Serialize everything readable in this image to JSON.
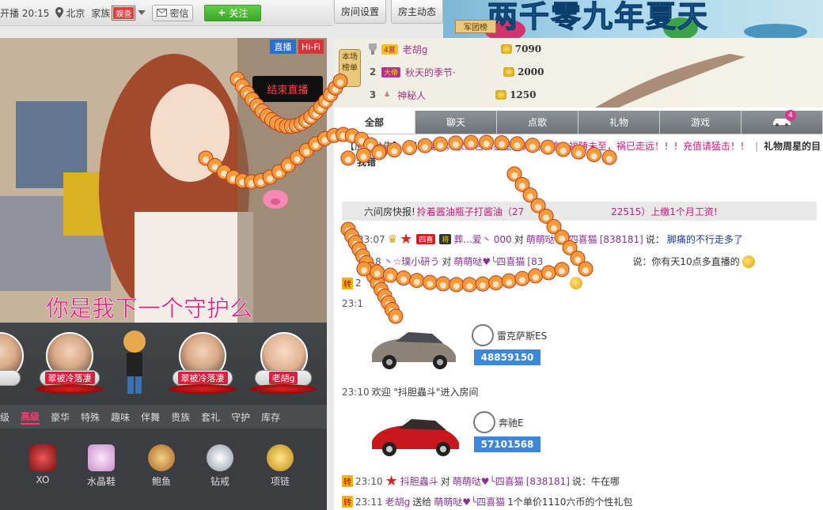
{
  "topbar": {
    "live_time": "开播 20:15",
    "location": "北京",
    "family": "家族",
    "family_tag": "娱查",
    "message": "密信",
    "follow": "关注"
  },
  "room_buttons": {
    "settings": "房间设置",
    "host_news": "房主动态"
  },
  "banner": {
    "title": "两千零九年夏天",
    "army_rank": "军团榜"
  },
  "video": {
    "badge_live": "直播",
    "badge_hifi": "Hi-Fi",
    "end_live": "结束直播",
    "overlay_text": "你是我下一个守护么"
  },
  "avatars": [
    {
      "name": "翠被冷落凄"
    },
    {
      "name": "翠被冷落凄"
    },
    {
      "name": "老胡g"
    }
  ],
  "gift_tabs": [
    "级",
    "高级",
    "豪华",
    "特殊",
    "趣味",
    "伴舞",
    "贵族",
    "套礼",
    "守护",
    "库存"
  ],
  "gift_tabs_active": "高级",
  "gifts": [
    {
      "name": "XO",
      "color": "#b4232a"
    },
    {
      "name": "水晶鞋",
      "color": "#d8a6d8"
    },
    {
      "name": "鲍鱼",
      "color": "#c98a3a"
    },
    {
      "name": "钻戒",
      "color": "#9aa7b3"
    },
    {
      "name": "项链",
      "color": "#d4a52a"
    }
  ],
  "rank": {
    "label": "本场榜单",
    "rows": [
      {
        "num": "1",
        "badge": "4富",
        "name": "老胡g",
        "score": "7090"
      },
      {
        "num": "2",
        "badge": "大帝",
        "name": "秋天的季节·",
        "score": "2000"
      },
      {
        "num": "3",
        "badge": "",
        "name": "神秘人",
        "score": "1250"
      }
    ]
  },
  "chat_tabs": [
    "全部",
    "聊天",
    "点歌",
    "礼物",
    "游戏"
  ],
  "chat_tab_active": "全部",
  "car_count": "4",
  "chat": {
    "announcement_label": "【房间公告】:",
    "announcement": "招收爱管，求红包和星星！真诚相待，福随未至，祸已走远！！！充值请猛击！！",
    "weekly_star": "礼物周星的目",
    "line2_user": "我错",
    "express_label": "六间房快报!",
    "express_text": "拎着酱油瓶子打酱油（27",
    "express_text2": "22515）上缴1个月工资!",
    "m1": {
      "time": "23:07",
      "badge1": "四喜",
      "badge2": "将",
      "user": "葬...爱丶",
      "uid": "000",
      "to": "对",
      "target": "萌萌哒♥╰四喜猫",
      "target_id": "[838181]",
      "say": "说：",
      "text": "脚痛的不行走多了"
    },
    "m2": {
      "time": "8",
      "user": "丶☆璞小研う",
      "to": "对",
      "target": "萌萌哒♥╰四喜猫",
      "target_id": "[83",
      "text": "说：你有天10点多直播的"
    },
    "m3": {
      "zhuan": "转",
      "time": "2"
    },
    "m4": {
      "time": "23:1"
    },
    "car1": {
      "brand": "雷克萨斯ES",
      "num": "48859150"
    },
    "m5": {
      "time": "23:10",
      "text": "欢迎 \"抖胆蟲斗\"进入房间"
    },
    "car2": {
      "brand": "奔驰E",
      "num": "57101568"
    },
    "m6": {
      "zhuan": "转",
      "time": "23:10",
      "user": "抖胆蟲斗",
      "to": "对",
      "target": "萌萌哒♥╰四喜猫",
      "target_id": "[838181]",
      "text": "说：牛在哪"
    },
    "m7": {
      "zhuan": "转",
      "time": "23:11",
      "user": "老胡g",
      "action": "送给",
      "target": "萌萌哒♥╰四喜猫",
      "text": "1个单价1110六币的个性礼包"
    }
  }
}
